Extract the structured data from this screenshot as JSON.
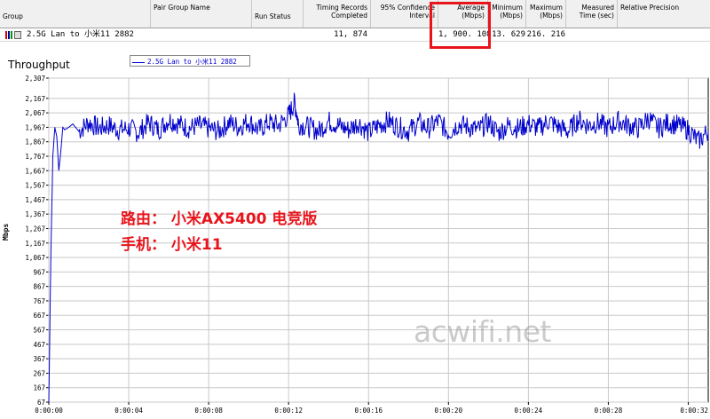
{
  "results_table": {
    "columns": [
      {
        "key": "group",
        "label": "Group"
      },
      {
        "key": "pair_group",
        "label": "Pair Group Name"
      },
      {
        "key": "run_status",
        "label": "Run Status"
      },
      {
        "key": "timing_records",
        "label": "Timing Records Completed"
      },
      {
        "key": "confidence",
        "label": "95% Confidence Interval"
      },
      {
        "key": "average",
        "label": "Average (Mbps)"
      },
      {
        "key": "minimum",
        "label": "Minimum (Mbps)"
      },
      {
        "key": "maximum",
        "label": "Maximum (Mbps)"
      },
      {
        "key": "measured_time",
        "label": "Measured Time (sec)"
      },
      {
        "key": "relative_precision",
        "label": "Relative Precision"
      }
    ],
    "row": {
      "pair": "2.5G Lan to 小米11 2882",
      "timing_records": "11, 874",
      "average": "1, 900. 108",
      "minimum": "13. 629",
      "maximum": "216. 216"
    }
  },
  "chart_data": {
    "type": "line",
    "title": "Throughput",
    "ylabel": "Mbps",
    "xlabel": "",
    "ylim": [
      67,
      2307
    ],
    "xlim": [
      0,
      33
    ],
    "y_ticks": [
      "67",
      "167",
      "267",
      "367",
      "467",
      "567",
      "667",
      "767",
      "867",
      "967",
      "1,067",
      "1,167",
      "1,267",
      "1,367",
      "1,467",
      "1,567",
      "1,667",
      "1,767",
      "1,867",
      "1,967",
      "2,067",
      "2,167",
      "2,307"
    ],
    "y_tick_values": [
      67,
      167,
      267,
      367,
      467,
      567,
      667,
      767,
      867,
      967,
      1067,
      1167,
      1267,
      1367,
      1467,
      1567,
      1667,
      1767,
      1867,
      1967,
      2067,
      2167,
      2307
    ],
    "x_ticks": [
      "0:00:00",
      "0:00:04",
      "0:00:08",
      "0:00:12",
      "0:00:16",
      "0:00:20",
      "0:00:24",
      "0:00:28",
      "0:00:32"
    ],
    "x_tick_values": [
      0,
      4,
      8,
      12,
      16,
      20,
      24,
      28,
      32
    ],
    "grid": true,
    "legend_position": "top-left",
    "series": [
      {
        "name": "2.5G Lan to 小米11 2882",
        "color": "#0000cc",
        "x": [
          0.0,
          0.1,
          0.2,
          0.3,
          0.4,
          0.5,
          0.6,
          0.7,
          0.8,
          1.0,
          1.2,
          1.5,
          2.0,
          2.5,
          3.0,
          3.5,
          4.0,
          4.5,
          5.0,
          5.5,
          6.0,
          6.5,
          7.0,
          7.5,
          8.0,
          8.5,
          9.0,
          9.5,
          10.0,
          10.5,
          11.0,
          11.5,
          12.0,
          12.3,
          12.5,
          13.0,
          13.5,
          14.0,
          14.5,
          15.0,
          15.5,
          16.0,
          16.5,
          17.0,
          17.5,
          18.0,
          18.5,
          19.0,
          19.5,
          20.0,
          20.5,
          21.0,
          21.5,
          22.0,
          22.5,
          23.0,
          23.5,
          24.0,
          24.5,
          25.0,
          25.5,
          26.0,
          26.5,
          27.0,
          27.5,
          28.0,
          28.5,
          29.0,
          29.5,
          30.0,
          30.5,
          31.0,
          31.5,
          32.0,
          32.5,
          33.0
        ],
        "y": [
          67,
          1067,
          1767,
          1967,
          1900,
          1667,
          1800,
          1967,
          1950,
          1967,
          1990,
          1940,
          2000,
          1960,
          1980,
          1950,
          1960,
          1930,
          2000,
          1950,
          2020,
          1990,
          1960,
          1980,
          1960,
          1940,
          2000,
          1970,
          2010,
          1950,
          2000,
          1980,
          2050,
          2140,
          1990,
          1970,
          1940,
          2010,
          1980,
          1950,
          2000,
          1930,
          1980,
          2010,
          1970,
          1940,
          2000,
          1960,
          2010,
          1930,
          1990,
          1970,
          1950,
          2000,
          1930,
          1980,
          1960,
          1990,
          1960,
          2010,
          1970,
          1940,
          2020,
          1980,
          2000,
          1960,
          2010,
          1980,
          1960,
          2030,
          1960,
          2000,
          1980,
          1950,
          1870,
          1940
        ]
      }
    ]
  },
  "annotations": {
    "router": "路由： 小米AX5400 电竞版",
    "phone": "手机： 小米11"
  },
  "watermark": "acwifi.net",
  "colors": {
    "series": "#0000cc",
    "highlight": "#e8141c",
    "annotation": "#e8141c"
  }
}
